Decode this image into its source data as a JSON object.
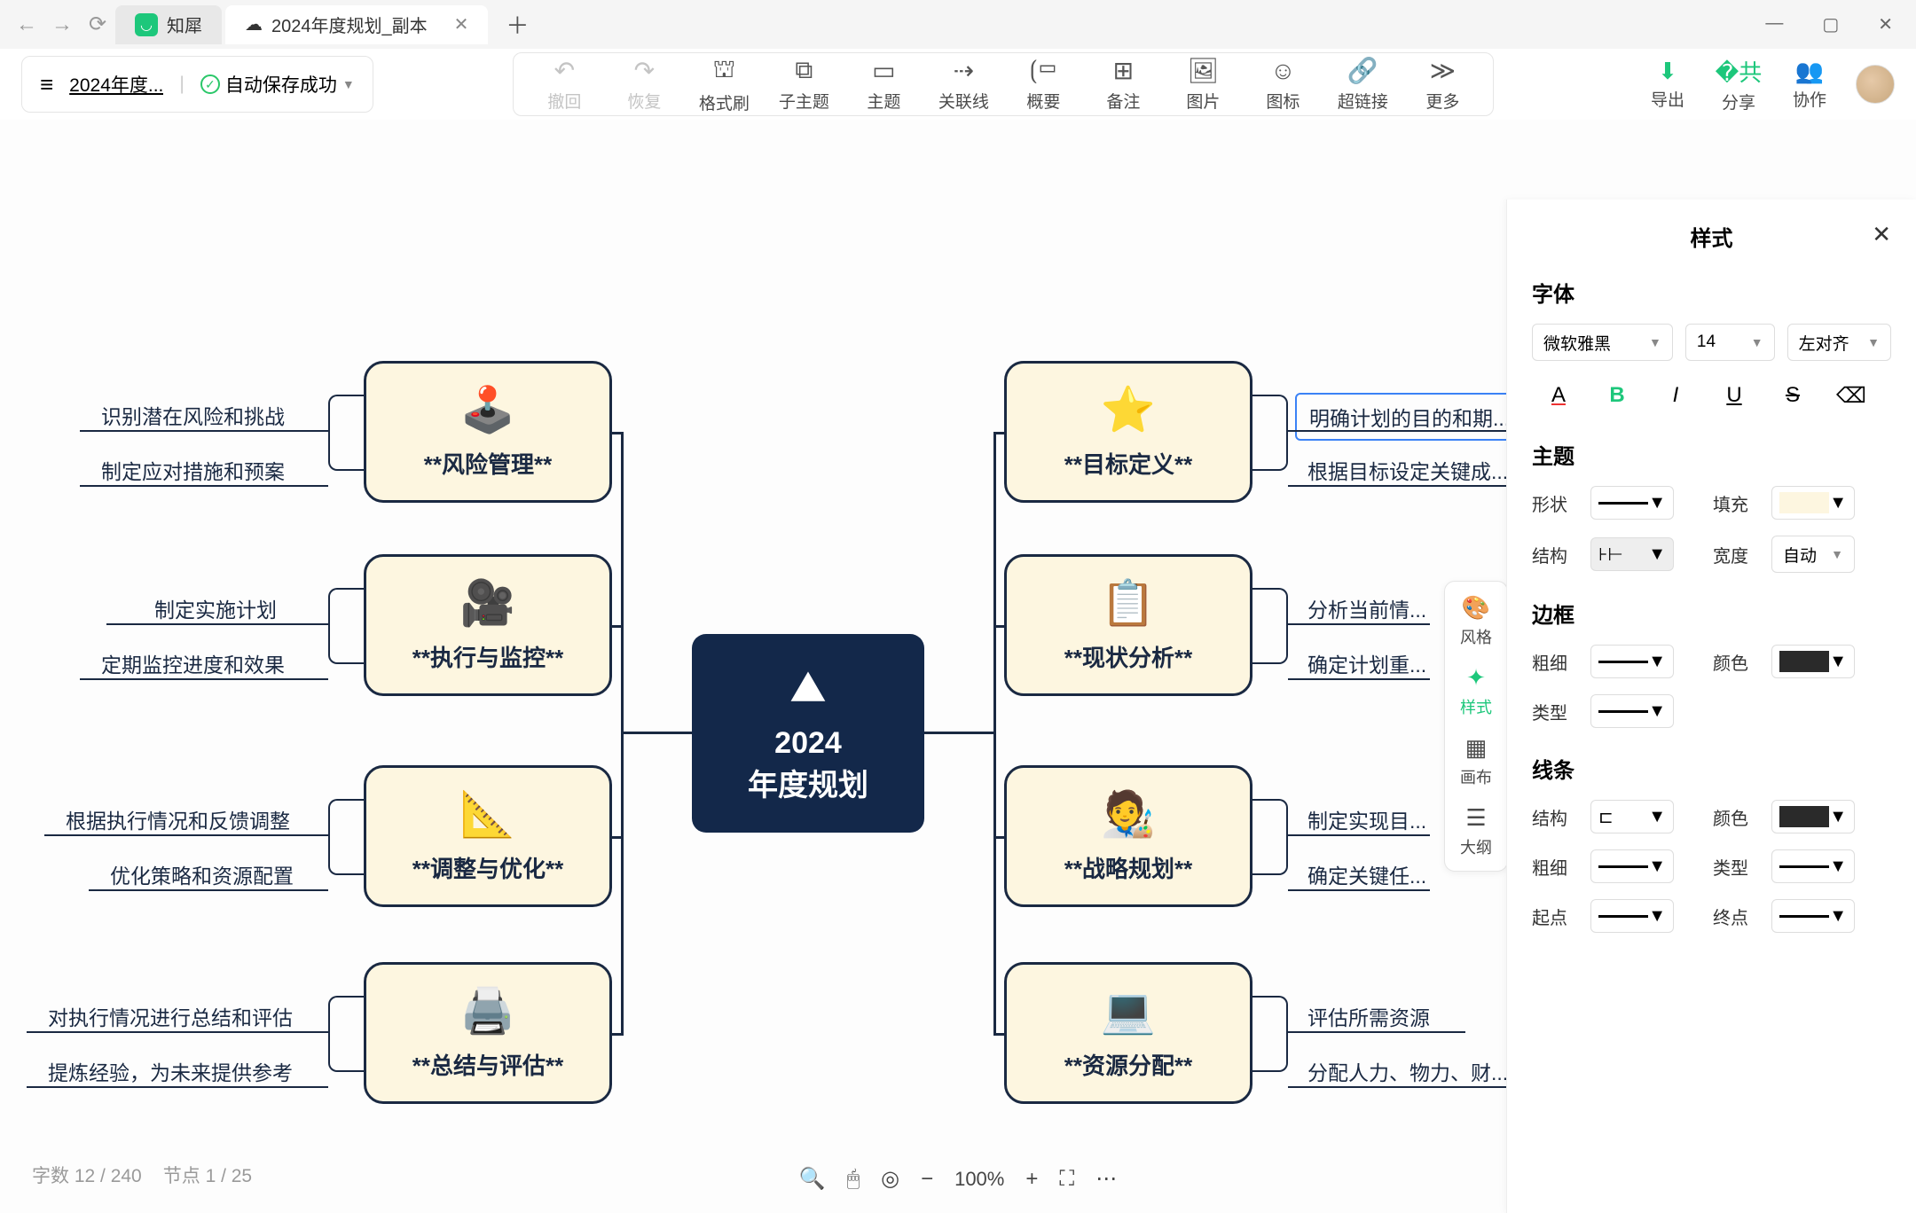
{
  "browser": {
    "app_tab": "知犀",
    "doc_tab": "2024年度规划_副本"
  },
  "doc": {
    "name": "2024年度...",
    "autosave": "自动保存成功"
  },
  "toolbar": {
    "undo": "撤回",
    "redo": "恢复",
    "format_brush": "格式刷",
    "subtopic": "子主题",
    "topic": "主题",
    "relation": "关联线",
    "summary": "概要",
    "note": "备注",
    "image": "图片",
    "icon": "图标",
    "hyperlink": "超链接",
    "more": "更多"
  },
  "actions": {
    "export": "导出",
    "share": "分享",
    "collab": "协作"
  },
  "central": {
    "line1": "2024",
    "line2": "年度规划"
  },
  "branches": {
    "left": [
      {
        "label": "**风险管理**",
        "leaves": [
          "识别潜在风险和挑战",
          "制定应对措施和预案"
        ]
      },
      {
        "label": "**执行与监控**",
        "leaves": [
          "制定实施计划",
          "定期监控进度和效果"
        ]
      },
      {
        "label": "**调整与优化**",
        "leaves": [
          "根据执行情况和反馈调整",
          "优化策略和资源配置"
        ]
      },
      {
        "label": "**总结与评估**",
        "leaves": [
          "对执行情况进行总结和评估",
          "提炼经验，为未来提供参考"
        ]
      }
    ],
    "right": [
      {
        "label": "**目标定义**",
        "leaves": [
          "明确计划的目的和期...",
          "根据目标设定关键成..."
        ],
        "selected": true
      },
      {
        "label": "**现状分析**",
        "leaves": [
          "分析当前情...",
          "确定计划重..."
        ]
      },
      {
        "label": "**战略规划**",
        "leaves": [
          "制定实现目...",
          "确定关键任..."
        ]
      },
      {
        "label": "**资源分配**",
        "leaves": [
          "评估所需资源",
          "分配人力、物力、财..."
        ]
      }
    ]
  },
  "side_tabs": {
    "style_group": "风格",
    "style": "样式",
    "canvas": "画布",
    "outline": "大纲"
  },
  "panel": {
    "title": "样式",
    "font_section": "字体",
    "font_family": "微软雅黑",
    "font_size": "14",
    "align": "左对齐",
    "topic_section": "主题",
    "shape": "形状",
    "fill": "填充",
    "structure": "结构",
    "width": "宽度",
    "width_val": "自动",
    "border_section": "边框",
    "thickness": "粗细",
    "color": "颜色",
    "type": "类型",
    "line_section": "线条",
    "line_structure": "结构",
    "line_color": "颜色",
    "line_thickness": "粗细",
    "line_type": "类型",
    "line_start": "起点",
    "line_end": "终点"
  },
  "status": {
    "chars": "字数  12 / 240",
    "nodes": "节点  1 / 25",
    "zoom": "100%"
  }
}
